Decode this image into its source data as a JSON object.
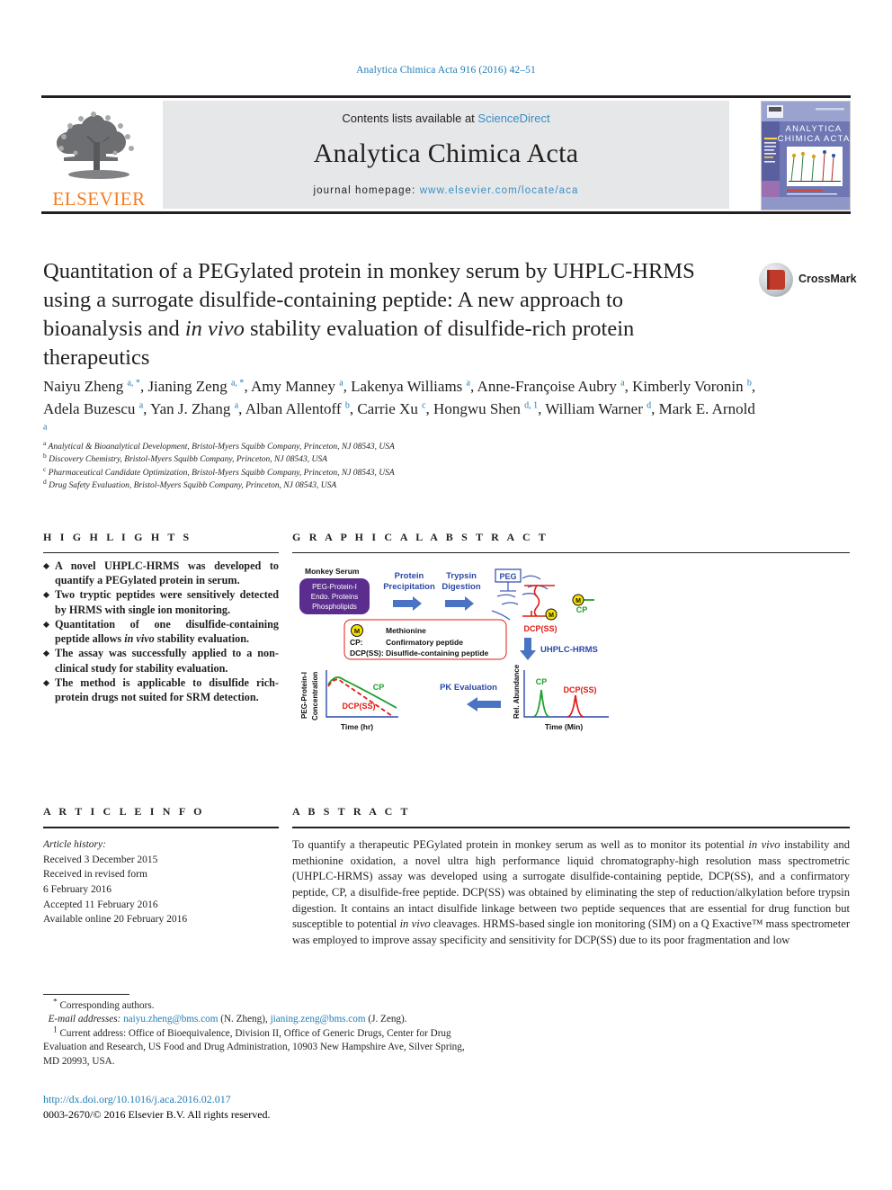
{
  "running_head": "Analytica Chimica Acta 916 (2016) 42–51",
  "masthead": {
    "publisher_logo_text": "ELSEVIER",
    "contents_prefix": "Contents lists available at ",
    "contents_link": "ScienceDirect",
    "journal_name": "Analytica Chimica Acta",
    "homepage_prefix": "journal homepage: ",
    "homepage_url": "www.elsevier.com/locate/aca",
    "cover_journal_title_line1": "ANALYTICA",
    "cover_journal_title_line2": "CHIMICA ACTA"
  },
  "article": {
    "title_part1": "Quantitation of a PEGylated protein in monkey serum by UHPLC-HRMS using a surrogate disulfide-containing peptide: A new approach to bioanalysis and ",
    "title_italic": "in vivo",
    "title_part2": " stability evaluation of disulfide-rich protein therapeutics",
    "crossmark_label": "CrossMark"
  },
  "authors": [
    {
      "name": "Naiyu Zheng",
      "sups": "a, *",
      "sep": ", "
    },
    {
      "name": "Jianing Zeng",
      "sups": "a, *",
      "sep": ", "
    },
    {
      "name": "Amy Manney",
      "sups": "a",
      "sep": ", "
    },
    {
      "name": "Lakenya Williams",
      "sups": "a",
      "sep": ", "
    },
    {
      "name": "Anne-Françoise Aubry",
      "sups": "a",
      "sep": ", "
    },
    {
      "name": "Kimberly Voronin",
      "sups": "b",
      "sep": ", "
    },
    {
      "name": "Adela Buzescu",
      "sups": "a",
      "sep": ", "
    },
    {
      "name": "Yan J. Zhang",
      "sups": "a",
      "sep": ", "
    },
    {
      "name": "Alban Allentoff",
      "sups": "b",
      "sep": ", "
    },
    {
      "name": "Carrie Xu",
      "sups": "c",
      "sep": ", "
    },
    {
      "name": "Hongwu Shen",
      "sups": "d, 1",
      "sep": ", "
    },
    {
      "name": "William Warner",
      "sups": "d",
      "sep": ", "
    },
    {
      "name": "Mark E. Arnold",
      "sups": "a",
      "sep": ""
    }
  ],
  "affiliations": [
    {
      "marker": "a",
      "text": "Analytical & Bioanalytical Development, Bristol-Myers Squibb Company, Princeton, NJ 08543, USA"
    },
    {
      "marker": "b",
      "text": "Discovery Chemistry, Bristol-Myers Squibb Company, Princeton, NJ 08543, USA"
    },
    {
      "marker": "c",
      "text": "Pharmaceutical Candidate Optimization, Bristol-Myers Squibb Company, Princeton, NJ 08543, USA"
    },
    {
      "marker": "d",
      "text": "Drug Safety Evaluation, Bristol-Myers Squibb Company, Princeton, NJ 08543, USA"
    }
  ],
  "highlights": {
    "heading": "H I G H L I G H T S",
    "items": [
      {
        "pre": "A novel UHPLC-HRMS was developed to quantify a PEGylated protein in serum.",
        "italic": "",
        "post": ""
      },
      {
        "pre": "Two tryptic peptides were sensitively detected by HRMS with single ion monitoring.",
        "italic": "",
        "post": ""
      },
      {
        "pre": "Quantitation of one disulfide-containing peptide allows ",
        "italic": "in vivo",
        "post": " stability evaluation."
      },
      {
        "pre": "The assay was successfully applied to a non-clinical study for stability evaluation.",
        "italic": "",
        "post": ""
      },
      {
        "pre": "The method is applicable to disulfide rich-protein drugs not suited for SRM detection.",
        "italic": "",
        "post": ""
      }
    ]
  },
  "graphical_abstract": {
    "heading": "G R A P H I C A L   A B S T R A C T",
    "monkey_serum_label": "Monkey Serum",
    "serum_box_lines": [
      "PEG-Protein-I",
      "Endo. Proteins",
      "Phospholipids"
    ],
    "step1_line1": "Protein",
    "step1_line2": "Precipitation",
    "step2_line1": "Trypsin",
    "step2_line2": "Digestion",
    "peg_label": "PEG",
    "dcpss_label": "DCP(SS)",
    "cp_label": "CP",
    "met_letter": "M",
    "uhplc_label": "UHPLC-HRMS",
    "legend": [
      {
        "key": "M",
        "value": "Methionine"
      },
      {
        "key": "CP:",
        "value": "Confirmatory peptide"
      },
      {
        "key": "DCP(SS):",
        "value": "Disulfide-containing peptide"
      }
    ],
    "pk_label": "PK Evaluation",
    "left_chart": {
      "ylabel_line1": "PEG-Protein-I",
      "ylabel_line2": "Concentration",
      "xlabel": "Time (hr)",
      "series_cp": "CP",
      "series_dcpss": "DCP(SS)"
    },
    "right_chart": {
      "ylabel": "Rel. Abundance",
      "xlabel": "Time (Min)",
      "peak_cp": "CP",
      "peak_dcpss": "DCP(SS)"
    },
    "colors": {
      "purple": "#5b2d8e",
      "blue": "#2b49a8",
      "arrow_blue": "#4a73c4",
      "red": "#e01b14",
      "green": "#1d9e2e",
      "yellow": "#f5e000"
    }
  },
  "article_info": {
    "heading": "A R T I C L E   I N F O",
    "history_label": "Article history:",
    "lines": [
      "Received 3 December 2015",
      "Received in revised form",
      "6 February 2016",
      "Accepted 11 February 2016",
      "Available online 20 February 2016"
    ]
  },
  "abstract": {
    "heading": "A B S T R A C T",
    "p1": "To quantify a therapeutic PEGylated protein in monkey serum as well as to monitor its potential ",
    "i1": "in vivo",
    "p2": " instability and methionine oxidation, a novel ultra high performance liquid chromatography-high resolution mass spectrometric (UHPLC-HRMS) assay was developed using a surrogate disulfide-containing peptide, DCP(SS), and a confirmatory peptide, CP, a disulfide-free peptide. DCP(SS) was obtained by eliminating the step of reduction/alkylation before trypsin digestion. It contains an intact disulfide linkage between two peptide sequences that are essential for drug function but susceptible to potential ",
    "i2": "in vivo",
    "p3": " cleavages. HRMS-based single ion monitoring (SIM) on a Q Exactive™ mass spectrometer was employed to improve assay specificity and sensitivity for DCP(SS) due to its poor fragmentation and low"
  },
  "footer": {
    "corresponding_marker": "*",
    "corresponding_text": "Corresponding authors.",
    "email_label": "E-mail addresses:",
    "email1": "naiyu.zheng@bms.com",
    "email1_owner": "(N. Zheng),",
    "email2": "jianing.zeng@bms.com",
    "email2_owner": "(J. Zeng).",
    "current_address_marker": "1",
    "current_address": "Current address: Office of Bioequivalence, Division II, Office of Generic Drugs, Center for Drug Evaluation and Research, US Food and Drug Administration, 10903 New Hampshire Ave, Silver Spring, MD 20993, USA.",
    "doi": "http://dx.doi.org/10.1016/j.aca.2016.02.017",
    "copyright": "0003-2670/© 2016 Elsevier B.V. All rights reserved."
  }
}
